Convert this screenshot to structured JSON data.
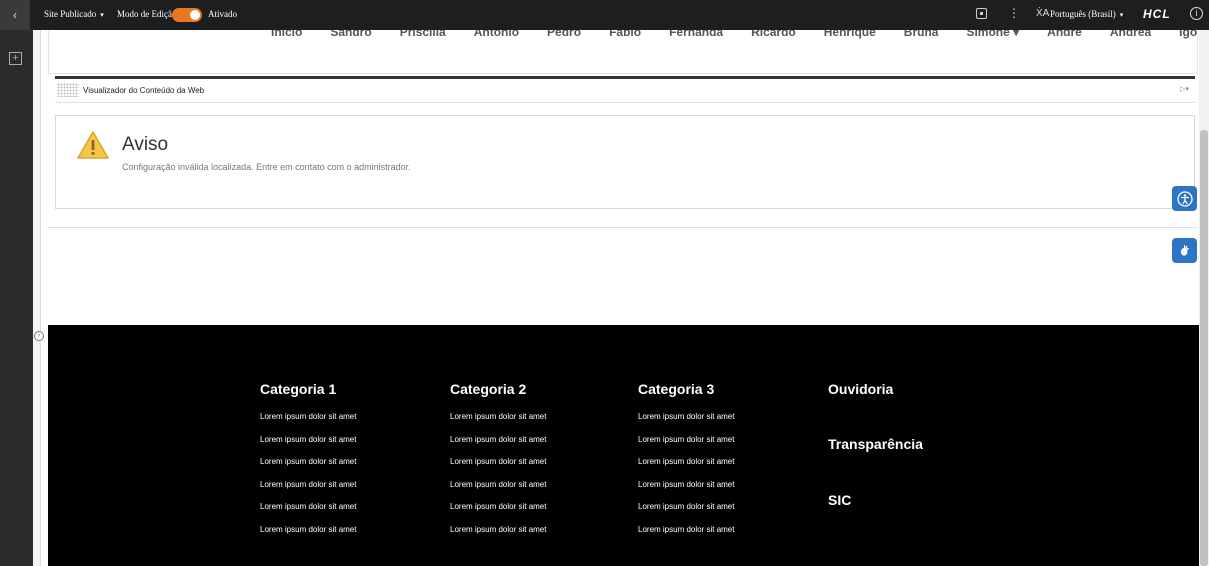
{
  "topbar": {
    "back_icon": "chevron-left-icon",
    "site_label": "Site Publicado",
    "edit_mode_label": "Modo de Edição:",
    "edit_mode_state": "Ativado",
    "language": "Português (Brasil)",
    "logo": "HCL",
    "info_icon": "ⓘ",
    "dots": "⋮",
    "lang_icon": "ẊA"
  },
  "nav": {
    "items": [
      "Início",
      "Sandro",
      "Priscilla",
      "Antônio",
      "Pedro",
      "Fábio",
      "Fernanda",
      "Ricardo",
      "Henrique",
      "Bruna",
      "Simone ▾",
      "André",
      "Andréa",
      "Igor"
    ]
  },
  "portlet": {
    "title": "Visualizador do Conteúdo da Web",
    "menu_icon": "▷▾"
  },
  "warning": {
    "title": "Aviso",
    "message": "Configuração inválida localizada. Entre em contato com o administrador."
  },
  "footer": {
    "columns": [
      {
        "title": "Categoria 1",
        "links": [
          "Lorem ipsum dolor sit amet",
          "Lorem ipsum dolor sit amet",
          "Lorem ipsum dolor sit amet",
          "Lorem ipsum dolor sit amet",
          "Lorem ipsum dolor sit amet",
          "Lorem ipsum dolor sit amet"
        ]
      },
      {
        "title": "Categoria 2",
        "links": [
          "Lorem ipsum dolor sit amet",
          "Lorem ipsum dolor sit amet",
          "Lorem ipsum dolor sit amet",
          "Lorem ipsum dolor sit amet",
          "Lorem ipsum dolor sit amet",
          "Lorem ipsum dolor sit amet"
        ]
      },
      {
        "title": "Categoria 3",
        "links": [
          "Lorem ipsum dolor sit amet",
          "Lorem ipsum dolor sit amet",
          "Lorem ipsum dolor sit amet",
          "Lorem ipsum dolor sit amet",
          "Lorem ipsum dolor sit amet",
          "Lorem ipsum dolor sit amet"
        ]
      }
    ],
    "ouvidoria": "Ouvidoria",
    "transparencia": "Transparência",
    "sic": "SIC"
  },
  "colors": {
    "toggle": "#e87722",
    "side_buttons": "#2e74c4",
    "footer_bg": "#000000",
    "toolbar_bg": "#1e1e1e"
  }
}
